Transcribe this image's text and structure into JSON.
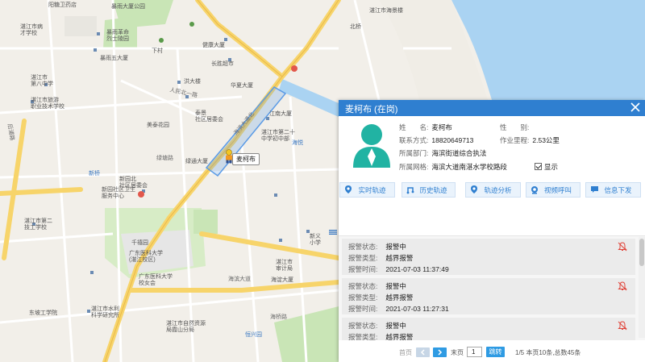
{
  "map": {
    "labels": {
      "yangxu_hospital": "阳糖卫药店",
      "shigeng_park": "暴雨大厦公园",
      "hospital_school": "湛江市病\n才学校",
      "dunhuang": "暴雨革命\n烈士陵园",
      "puke_road": "暴雨五大厦",
      "xiacun": "下村",
      "jianxin": "健康大厦",
      "changsheng": "长胜超市",
      "zhanjiang_eight": "湛江市\n第八中学",
      "zhanjiang_tech": "湛江市旅游\n职业技术学校",
      "renmin_north": "人民北一路",
      "hongxing": "洪大楼",
      "meiyuan": "美泰花园",
      "taijing": "泰景\n社区居委会",
      "huaxia": "华夏大厦",
      "zhanjiang_20": "湛江市第二十\n中学初中部",
      "haiyue": "海悦",
      "xinqiao": "新桥",
      "xinhuo_north": "新园北\n社区居委会",
      "xinhuo_health": "新园社区卫生\n服务中心",
      "zhanjiang_2nd": "湛江市第二\n技工学校",
      "guangdong_med": "广东医科大学\n(湛江校区)",
      "dongdong_med": "广东医科大学\n校女会",
      "qianxi": "千禧园",
      "dongpo": "东坡工学院",
      "zhanjiang_water": "湛江市水利\n科学研究所",
      "haixiang_market": "湛江市\n审计局",
      "haibin": "海淀大厦",
      "lvtong": "绿通大厦",
      "jiangnan": "江南大厦",
      "zhanjiang_nature": "湛江市自然资源\n局霞山分局",
      "haitian_bay": "海滨大道",
      "hengxing": "恒兴园",
      "beiqiao": "北桥",
      "xinyi": "新义\n小学",
      "haiqiao_road": "海桥路",
      "haixiang": "湛江市海景楼",
      "road_main": "海滨大道北",
      "west_road": "绿塘路",
      "houpu": "后浦路"
    }
  },
  "poi": {
    "name": "麦柯布"
  },
  "panel": {
    "title": "麦柯布 (在岗)",
    "fields": {
      "name_label": "姓　　名:",
      "name_value": "麦柯布",
      "gender_label": "性　　别:",
      "gender_value": "",
      "phone_label": "联系方式:",
      "phone_value": "18820649713",
      "mileage_label": "作业里程:",
      "mileage_value": "2.53公里",
      "dept_label": "所属部门:",
      "dept_value": "海滨街道综合执法",
      "grid_label": "所属网格:",
      "grid_value": "海滨大道南湛水学校路段",
      "display_label": "显示"
    },
    "actions": [
      {
        "id": "realtime",
        "label": "实时轨迹"
      },
      {
        "id": "history",
        "label": "历史轨迹"
      },
      {
        "id": "analysis",
        "label": "轨迹分析"
      },
      {
        "id": "video",
        "label": "视频呼叫"
      },
      {
        "id": "message",
        "label": "信息下发"
      }
    ],
    "alarms": [
      {
        "status_label": "报警状态:",
        "status": "报警中",
        "type_label": "报警类型:",
        "type": "越界报警",
        "time_label": "报警时间:",
        "time": "2021-07-03 11:37:49"
      },
      {
        "status_label": "报警状态:",
        "status": "报警中",
        "type_label": "报警类型:",
        "type": "越界报警",
        "time_label": "报警时间:",
        "time": "2021-07-03 11:27:31"
      },
      {
        "status_label": "报警状态:",
        "status": "报警中",
        "type_label": "报警类型:",
        "type": "越界报警",
        "time_label": "报警时间:",
        "time": ""
      }
    ],
    "pager": {
      "first": "首页",
      "last": "末页",
      "page_value": "1",
      "go": "跳转",
      "summary": "1/5 本页10条,总数45条"
    }
  },
  "colors": {
    "header": "#2f7fd0",
    "water": "#aad3f2",
    "green": "#c9e5b6",
    "road_major": "#f7d46a",
    "route": "#5b9be6"
  }
}
